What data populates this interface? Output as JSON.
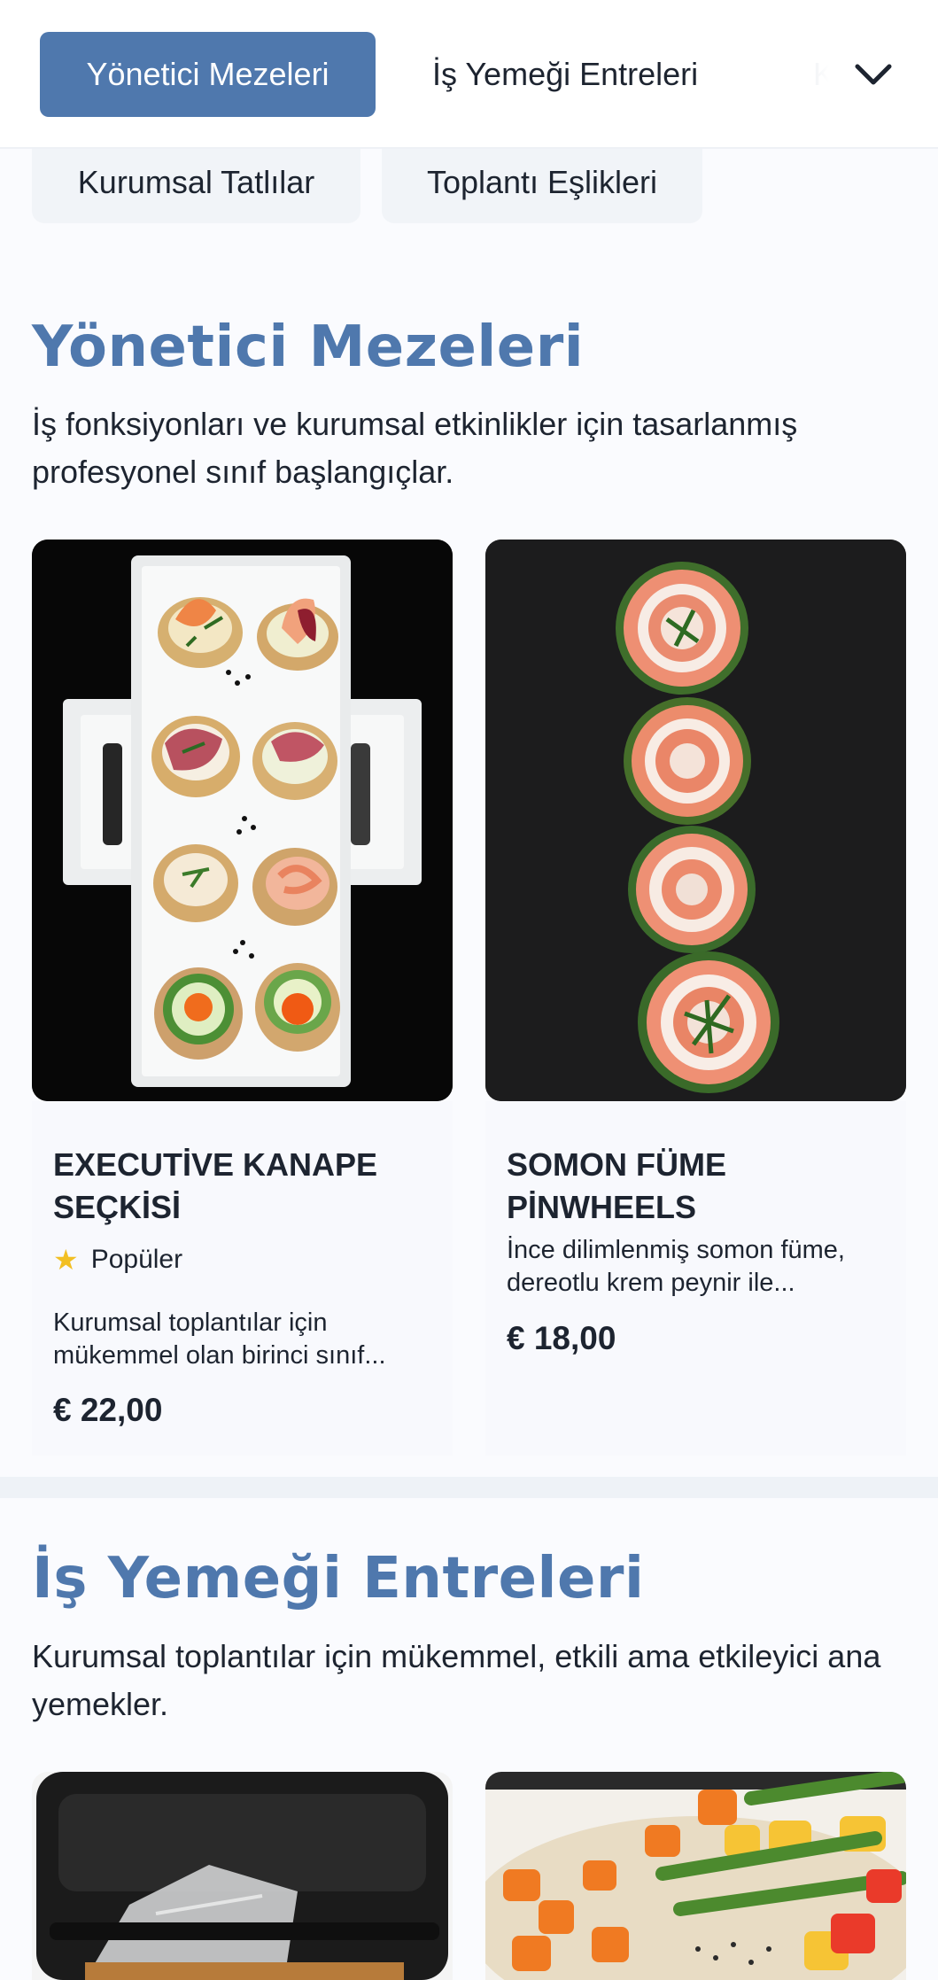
{
  "nav": {
    "tabs": [
      {
        "label": "Yönetici Mezeleri",
        "active": true
      },
      {
        "label": "İş Yemeği Entreleri",
        "active": false
      },
      {
        "label": "K",
        "active": false
      }
    ],
    "pills": [
      {
        "label": "Kurumsal Tatlılar"
      },
      {
        "label": "Toplantı Eşlikleri"
      }
    ],
    "expand_icon": "chevron-down-icon"
  },
  "sections": [
    {
      "title": "Yönetici Mezeleri",
      "description": "İş fonksiyonları ve kurumsal etkinlikler için tasarlanmış profesyonel sınıf başlangıçlar.",
      "items": [
        {
          "name": "EXECUTİVE KANAPE SEÇKİSİ",
          "badge": "Popüler",
          "badge_icon": "star-icon",
          "description": "Kurumsal toplantılar için mükemmel olan birinci sınıf...",
          "price": "€ 22,00"
        },
        {
          "name": "SOMON FÜME PİNWHEELS",
          "description": "İnce dilimlenmiş somon füme, dereotlu krem peynir ile...",
          "price": "€ 18,00"
        }
      ]
    },
    {
      "title": "İş Yemeği Entreleri",
      "description": "Kurumsal toplantılar için mükemmel, etkili ama etkileyici ana yemekler."
    }
  ],
  "colors": {
    "accent": "#4f78ad",
    "star": "#f2bf23",
    "text": "#1d2430",
    "background": "#fafbfe"
  }
}
